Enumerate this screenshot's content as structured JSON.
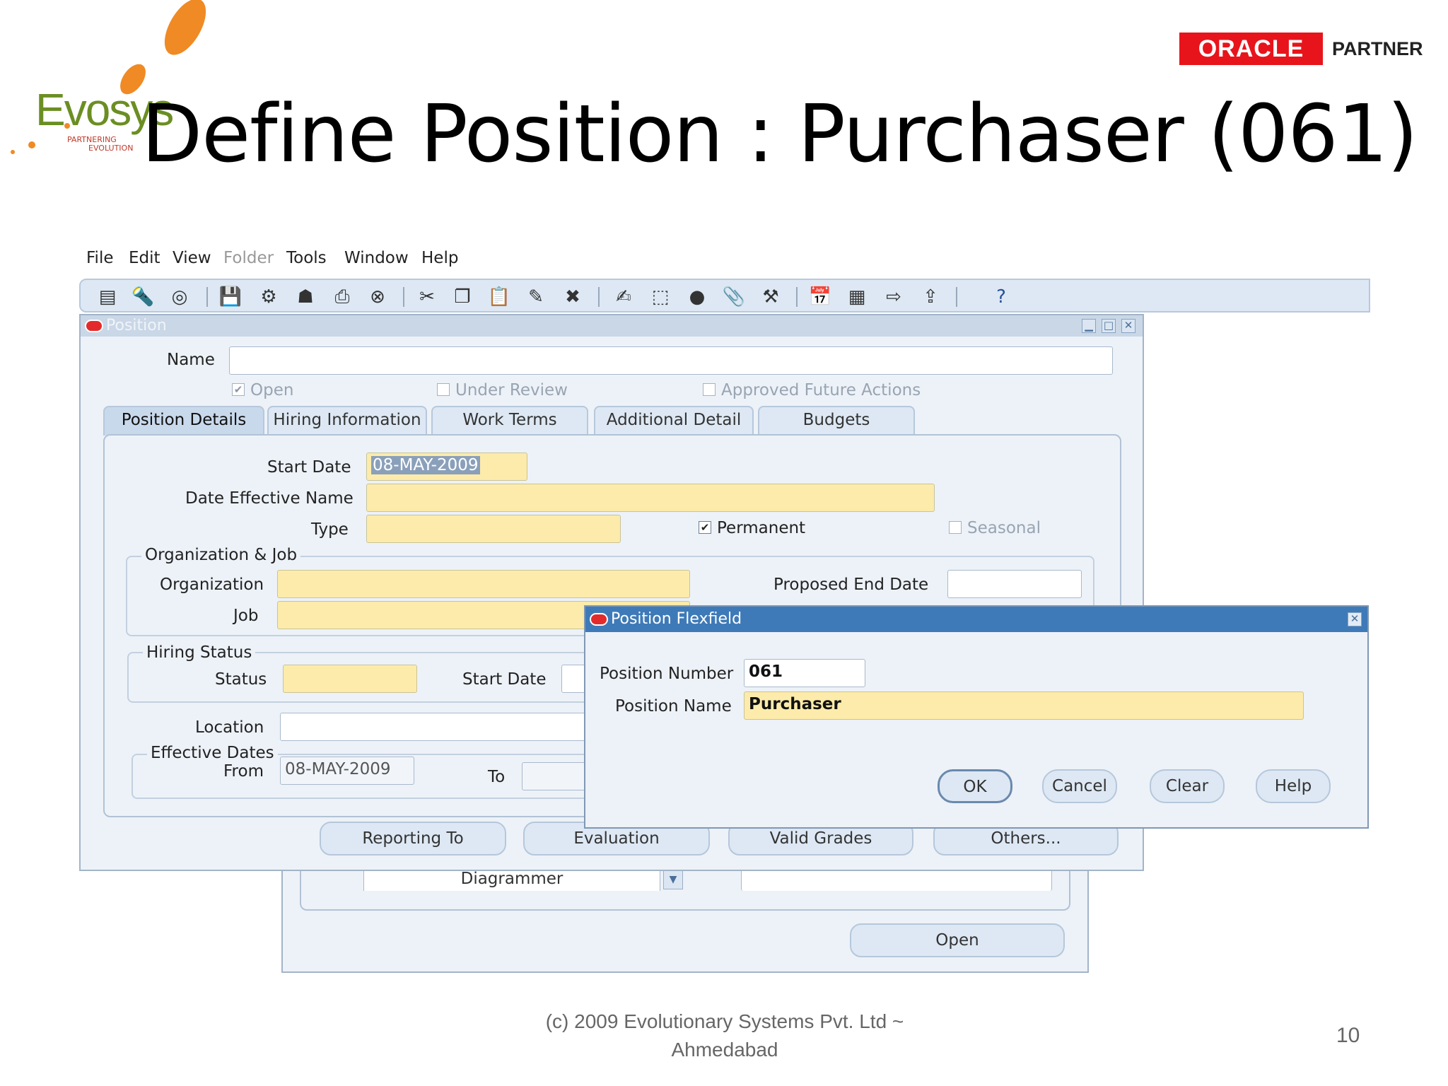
{
  "slide": {
    "logo_text": "Evosys",
    "logo_tagline_1": "PARTNERING",
    "logo_tagline_2": "EVOLUTION",
    "title": "Define Position : Purchaser (061)",
    "oracle_label": "ORACLE",
    "partner_label": "PARTNER",
    "footer_line1": "(c) 2009 Evolutionary Systems Pvt. Ltd ~",
    "footer_line2": "Ahmedabad",
    "page_number": "10"
  },
  "menu": [
    "File",
    "Edit",
    "View",
    "Folder",
    "Tools",
    "Window",
    "Help"
  ],
  "toolbar": {
    "icons": [
      "new-record-icon",
      "find-icon",
      "navigator-icon",
      "save-icon",
      "next-step-icon",
      "switch-responsibility-icon",
      "print-icon",
      "close-form-icon",
      "cut-icon",
      "copy-icon",
      "paste-icon",
      "clear-record-icon",
      "delete-record-icon",
      "edit-field-icon",
      "zoom-icon",
      "translations-icon",
      "attachments-icon",
      "folder-tools-icon",
      "calendar-icon",
      "workdays-icon",
      "navigate-icon",
      "export-icon",
      "help-icon"
    ],
    "help_glyph": "?"
  },
  "position_window": {
    "title": "Position",
    "name_label": "Name",
    "name_value": "",
    "open_label": "Open",
    "under_review_label": "Under Review",
    "approved_label": "Approved Future Actions",
    "tabs": [
      "Position Details",
      "Hiring Information",
      "Work Terms",
      "Additional Detail",
      "Budgets"
    ],
    "start_date_label": "Start Date",
    "start_date_value": "08-MAY-2009",
    "den_label": "Date Effective Name",
    "type_label": "Type",
    "permanent_label": "Permanent",
    "seasonal_label": "Seasonal",
    "org_job_group": "Organization & Job",
    "organization_label": "Organization",
    "job_label": "Job",
    "proposed_end_label": "Proposed End Date",
    "hiring_status_group": "Hiring Status",
    "status_label": "Status",
    "hs_start_date_label": "Start Date",
    "location_label": "Location",
    "eff_dates_label": "Effective Dates",
    "from_label": "From",
    "from_value": "08-MAY-2009",
    "to_label": "To",
    "buttons": [
      "Reporting To",
      "Evaluation",
      "Valid Grades",
      "Others..."
    ]
  },
  "background_window": {
    "dropdown_value": "Diagrammer",
    "open_button": "Open"
  },
  "flexfield_dialog": {
    "title": "Position Flexfield",
    "position_number_label": "Position Number",
    "position_number_value": "061",
    "position_name_label": "Position Name",
    "position_name_value": "Purchaser",
    "buttons": [
      "OK",
      "Cancel",
      "Clear",
      "Help"
    ]
  },
  "colors": {
    "required_field": "#fcebaa",
    "active_title": "#3e7ab8",
    "oracle_red": "#e8141b"
  }
}
